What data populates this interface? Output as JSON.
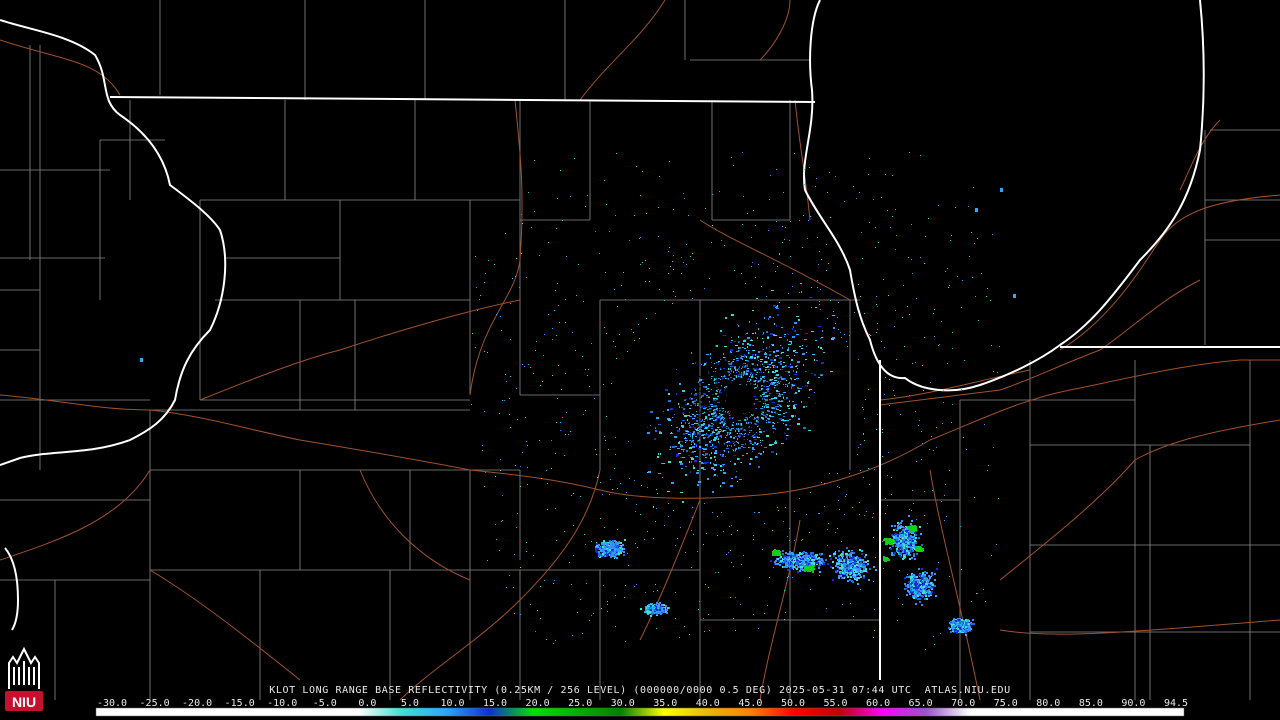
{
  "product": {
    "caption": "KLOT LONG RANGE BASE REFLECTIVITY (0.25KM / 256 LEVEL) (000000/0000 0.5 DEG) 2025-05-31 07:44 UTC  ATLAS.NIU.EDU"
  },
  "logo": {
    "text": "NIU",
    "color": "#c8102e"
  },
  "colorbar": {
    "ticks": [
      "-30.0",
      "-25.0",
      "-20.0",
      "-15.0",
      "-10.0",
      "-5.0",
      "0.0",
      "5.0",
      "10.0",
      "15.0",
      "20.0",
      "25.0",
      "30.0",
      "35.0",
      "40.0",
      "45.0",
      "50.0",
      "55.0",
      "60.0",
      "65.0",
      "70.0",
      "75.0",
      "80.0",
      "85.0",
      "90.0",
      "94.5"
    ],
    "stops": [
      {
        "dbz": -30,
        "color": "#ffffff"
      },
      {
        "dbz": 0,
        "color": "#ffffff"
      },
      {
        "dbz": 5,
        "color": "#40e0d0"
      },
      {
        "dbz": 10,
        "color": "#2aa8ff"
      },
      {
        "dbz": 15,
        "color": "#1030d0"
      },
      {
        "dbz": 20,
        "color": "#00e000"
      },
      {
        "dbz": 25,
        "color": "#00b000"
      },
      {
        "dbz": 30,
        "color": "#008000"
      },
      {
        "dbz": 35,
        "color": "#ffff00"
      },
      {
        "dbz": 40,
        "color": "#e8b800"
      },
      {
        "dbz": 45,
        "color": "#ff8000"
      },
      {
        "dbz": 50,
        "color": "#ff0000"
      },
      {
        "dbz": 55,
        "color": "#c00000"
      },
      {
        "dbz": 60,
        "color": "#ff00ff"
      },
      {
        "dbz": 65,
        "color": "#9955cc"
      },
      {
        "dbz": 70,
        "color": "#ffffff"
      },
      {
        "dbz": 94.5,
        "color": "#ffffff"
      }
    ]
  },
  "colors": {
    "background": "#000000",
    "state_border": "#ffffff",
    "county_line": "#8a8a8a",
    "highway": "#a0522d"
  },
  "echoes": {
    "main_cluster_dbz_range": [
      5,
      15
    ],
    "storm_cells_dbz_range": [
      10,
      25
    ]
  }
}
